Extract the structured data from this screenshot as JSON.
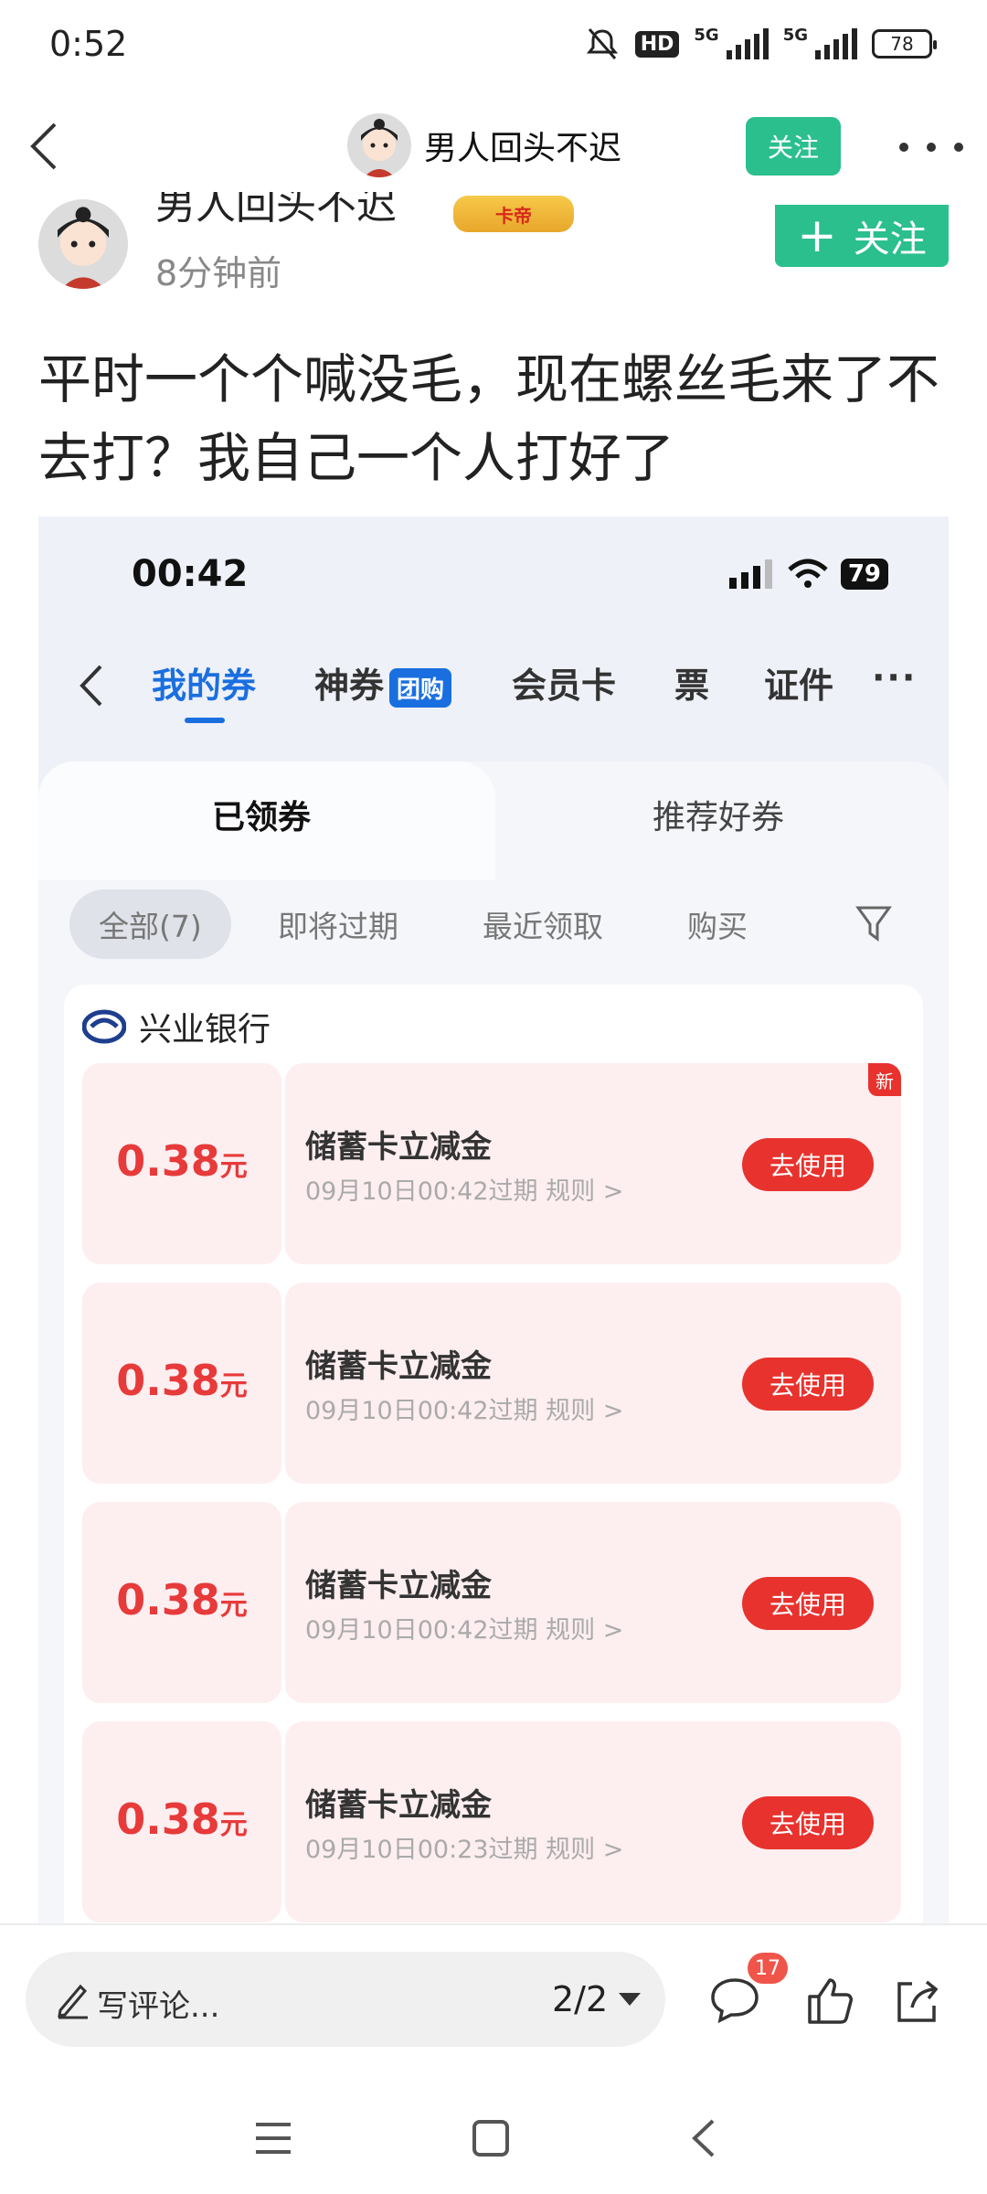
{
  "status_bar": {
    "time": "0:52",
    "hd_label": "HD",
    "net1": "5G",
    "net2": "5G",
    "battery": "78"
  },
  "header": {
    "username": "男人回头不迟",
    "follow_label": "关注"
  },
  "author": {
    "name": "男人回头不迟",
    "badge": "卡帝",
    "time_ago": "8分钟前",
    "follow_label": "关注",
    "follow_plus": "+"
  },
  "post": {
    "text": "平时一个个喊没毛，现在螺丝毛来了不去打？我自己一个人打好了"
  },
  "screenshot": {
    "time": "00:42",
    "battery": "79",
    "nav_tabs": [
      {
        "label": "我的券"
      },
      {
        "label": "神券"
      },
      {
        "label": "会员卡"
      },
      {
        "label": "票"
      },
      {
        "label": "证件"
      }
    ],
    "tuan_badge": "团购",
    "segments": [
      "已领券",
      "推荐好券"
    ],
    "filters": [
      "全部(7)",
      "即将过期",
      "最近领取",
      "购买"
    ],
    "bank": "兴业银行",
    "coupons": [
      {
        "amount": "0.38",
        "unit": "元",
        "title": "储蓄卡立减金",
        "expire": "09月10日00:42过期",
        "rule": "规则 >",
        "button": "去使用",
        "new_tag": "新"
      },
      {
        "amount": "0.38",
        "unit": "元",
        "title": "储蓄卡立减金",
        "expire": "09月10日00:42过期",
        "rule": "规则 >",
        "button": "去使用"
      },
      {
        "amount": "0.38",
        "unit": "元",
        "title": "储蓄卡立减金",
        "expire": "09月10日00:42过期",
        "rule": "规则 >",
        "button": "去使用"
      },
      {
        "amount": "0.38",
        "unit": "元",
        "title": "储蓄卡立减金",
        "expire": "09月10日00:23过期",
        "rule": "规则 >",
        "button": "去使用"
      }
    ]
  },
  "bottom_bar": {
    "comment_placeholder": "写评论...",
    "pager": "2/2",
    "comment_count": "17"
  },
  "colors": {
    "accent_green": "#2bbf8e",
    "accent_blue": "#1a6fe0",
    "coupon_red": "#e8322d"
  }
}
